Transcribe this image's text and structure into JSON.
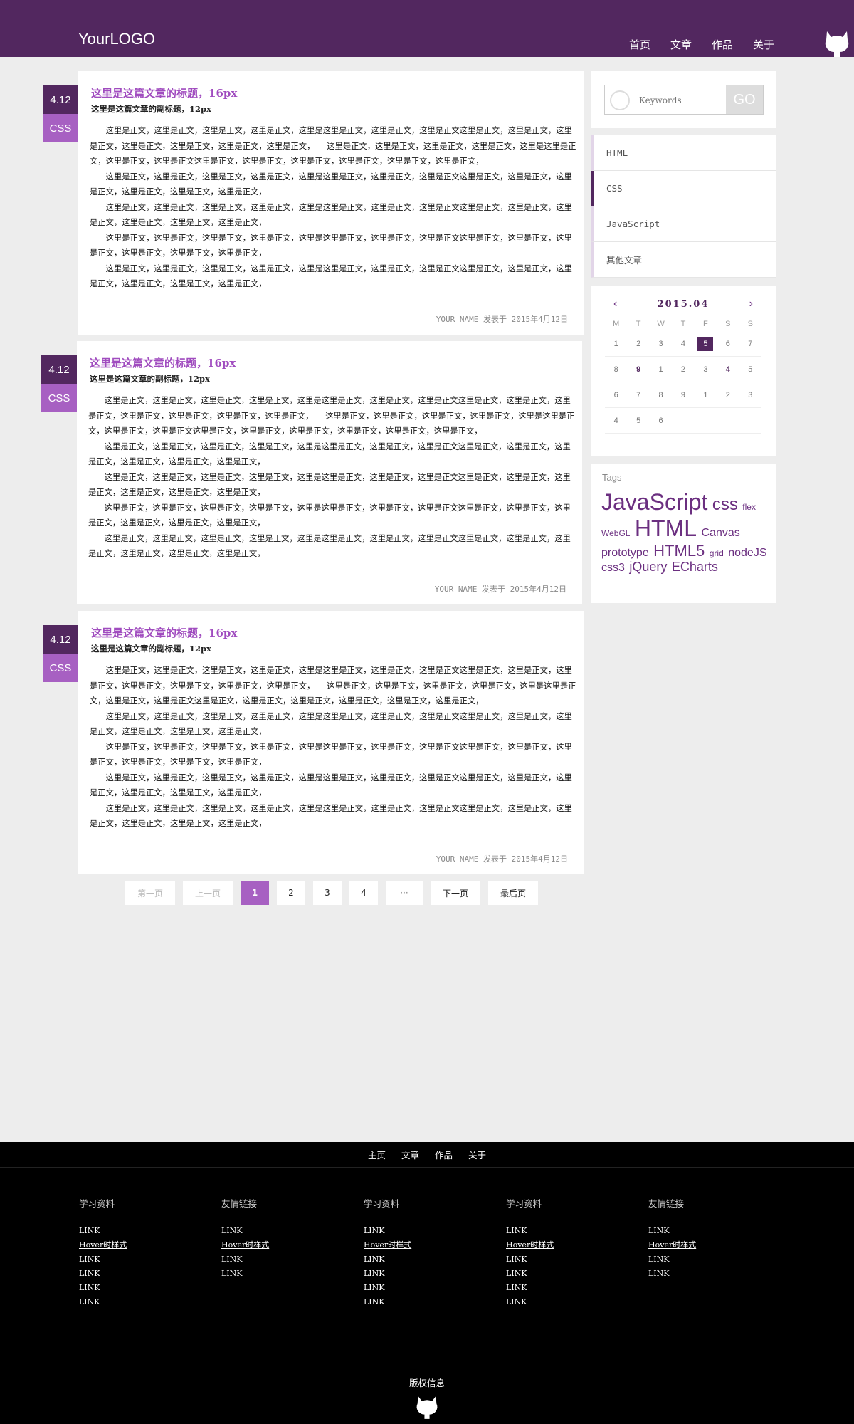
{
  "header": {
    "logo": "YourLOGO",
    "nav": [
      "首页",
      "文章",
      "作品",
      "关于"
    ]
  },
  "articles": [
    {
      "date": "4.12",
      "category": "CSS",
      "title": "这里是这篇文章的标题，16px",
      "subtitle": "这里是这篇文章的副标题，12px",
      "paragraphs": [
        "这里是正文，这里是正文，这里是正文，这里是正文，这里是这里是正文，这里是正文，这里是正文这里是正文，这里是正文，这里是正文，这里是正文，这里是正文，这里是正文，这里是正文，　　这里是正文，这里是正文，这里是正文，这里是正文，这里是这里是正文，这里是正文，这里是正文这里是正文，这里是正文，这里是正文，这里是正文，这里是正文，这里是正文，",
        "这里是正文，这里是正文，这里是正文，这里是正文，这里是这里是正文，这里是正文，这里是正文这里是正文，这里是正文，这里是正文，这里是正文，这里是正文，这里是正文，",
        "这里是正文，这里是正文，这里是正文，这里是正文，这里是这里是正文，这里是正文，这里是正文这里是正文，这里是正文，这里是正文，这里是正文，这里是正文，这里是正文，",
        "这里是正文，这里是正文，这里是正文，这里是正文，这里是这里是正文，这里是正文，这里是正文这里是正文，这里是正文，这里是正文，这里是正文，这里是正文，这里是正文，",
        "这里是正文，这里是正文，这里是正文，这里是正文，这里是这里是正文，这里是正文，这里是正文这里是正文，这里是正文，这里是正文，这里是正文，这里是正文，这里是正文，"
      ],
      "footer": "YOUR NAME 发表于 2015年4月12日"
    },
    {
      "date": "4.12",
      "category": "CSS",
      "title": "这里是这篇文章的标题，16px",
      "subtitle": "这里是这篇文章的副标题，12px",
      "paragraphs": [
        "这里是正文，这里是正文，这里是正文，这里是正文，这里是这里是正文，这里是正文，这里是正文这里是正文，这里是正文，这里是正文，这里是正文，这里是正文，这里是正文，这里是正文，　　这里是正文，这里是正文，这里是正文，这里是正文，这里是这里是正文，这里是正文，这里是正文这里是正文，这里是正文，这里是正文，这里是正文，这里是正文，这里是正文，",
        "这里是正文，这里是正文，这里是正文，这里是正文，这里是这里是正文，这里是正文，这里是正文这里是正文，这里是正文，这里是正文，这里是正文，这里是正文，这里是正文，",
        "这里是正文，这里是正文，这里是正文，这里是正文，这里是这里是正文，这里是正文，这里是正文这里是正文，这里是正文，这里是正文，这里是正文，这里是正文，这里是正文，",
        "这里是正文，这里是正文，这里是正文，这里是正文，这里是这里是正文，这里是正文，这里是正文这里是正文，这里是正文，这里是正文，这里是正文，这里是正文，这里是正文，",
        "这里是正文，这里是正文，这里是正文，这里是正文，这里是这里是正文，这里是正文，这里是正文这里是正文，这里是正文，这里是正文，这里是正文，这里是正文，这里是正文，"
      ],
      "footer": "YOUR NAME 发表于 2015年4月12日"
    },
    {
      "date": "4.12",
      "category": "CSS",
      "title": "这里是这篇文章的标题，16px",
      "subtitle": "这里是这篇文章的副标题，12px",
      "paragraphs": [
        "这里是正文，这里是正文，这里是正文，这里是正文，这里是这里是正文，这里是正文，这里是正文这里是正文，这里是正文，这里是正文，这里是正文，这里是正文，这里是正文，这里是正文，　　这里是正文，这里是正文，这里是正文，这里是正文，这里是这里是正文，这里是正文，这里是正文这里是正文，这里是正文，这里是正文，这里是正文，这里是正文，这里是正文，",
        "这里是正文，这里是正文，这里是正文，这里是正文，这里是这里是正文，这里是正文，这里是正文这里是正文，这里是正文，这里是正文，这里是正文，这里是正文，这里是正文，",
        "这里是正文，这里是正文，这里是正文，这里是正文，这里是这里是正文，这里是正文，这里是正文这里是正文，这里是正文，这里是正文，这里是正文，这里是正文，这里是正文，",
        "这里是正文，这里是正文，这里是正文，这里是正文，这里是这里是正文，这里是正文，这里是正文这里是正文，这里是正文，这里是正文，这里是正文，这里是正文，这里是正文，",
        "这里是正文，这里是正文，这里是正文，这里是正文，这里是这里是正文，这里是正文，这里是正文这里是正文，这里是正文，这里是正文，这里是正文，这里是正文，这里是正文，"
      ],
      "footer": "YOUR NAME 发表于 2015年4月12日"
    }
  ],
  "pagination": {
    "first": "第一页",
    "prev": "上一页",
    "pages": [
      "1",
      "2",
      "3",
      "4"
    ],
    "current": "1",
    "ellipsis": "···",
    "next": "下一页",
    "last": "最后页"
  },
  "sidebar": {
    "search": {
      "placeholder": "Keywords",
      "button": "GO"
    },
    "categories": [
      "HTML",
      "CSS",
      "JavaScript",
      "其他文章"
    ],
    "active_category": "CSS",
    "calendar": {
      "title": "2015.04",
      "prev": "‹",
      "next": "›",
      "weekdays": [
        "M",
        "T",
        "W",
        "T",
        "F",
        "S",
        "S"
      ],
      "rows": [
        [
          "1",
          "2",
          "3",
          "4",
          "5",
          "6",
          "7"
        ],
        [
          "8",
          "9",
          "1",
          "2",
          "3",
          "4",
          "5"
        ],
        [
          "6",
          "7",
          "8",
          "9",
          "1",
          "2",
          "3"
        ],
        [
          "4",
          "5",
          "6",
          "",
          "",
          "",
          ""
        ]
      ],
      "today": "5",
      "highlighted": [
        "9",
        "4"
      ]
    },
    "tags_title": "Tags",
    "tags": [
      {
        "text": "JavaScript",
        "size": 32
      },
      {
        "text": "css",
        "size": 24
      },
      {
        "text": "flex",
        "size": 12
      },
      {
        "text": "WebGL",
        "size": 12
      },
      {
        "text": "HTML",
        "size": 32
      },
      {
        "text": "Canvas",
        "size": 16
      },
      {
        "text": "prototype",
        "size": 16
      },
      {
        "text": "HTML5",
        "size": 22
      },
      {
        "text": "grid",
        "size": 12
      },
      {
        "text": "nodeJS",
        "size": 16
      },
      {
        "text": "css3",
        "size": 16
      },
      {
        "text": "jQuery",
        "size": 18
      },
      {
        "text": "ECharts",
        "size": 18
      }
    ]
  },
  "footer": {
    "nav": [
      "主页",
      "文章",
      "作品",
      "关于"
    ],
    "columns": [
      {
        "title": "学习资料",
        "links": [
          "LINK",
          "Hover时样式",
          "LINK",
          "LINK",
          "LINK",
          "LINK"
        ]
      },
      {
        "title": "友情链接",
        "links": [
          "LINK",
          "Hover时样式",
          "LINK",
          "LINK"
        ]
      },
      {
        "title": "学习资料",
        "links": [
          "LINK",
          "Hover时样式",
          "LINK",
          "LINK",
          "LINK",
          "LINK"
        ]
      },
      {
        "title": "学习资料",
        "links": [
          "LINK",
          "Hover时样式",
          "LINK",
          "LINK",
          "LINK",
          "LINK"
        ]
      },
      {
        "title": "友情链接",
        "links": [
          "LINK",
          "Hover时样式",
          "LINK",
          "LINK"
        ]
      }
    ],
    "copyright": "版权信息"
  },
  "icons": {
    "octocat": "github-octocat-icon",
    "search": "search-icon"
  },
  "colors": {
    "brand": "#52275f",
    "accent": "#a760c2",
    "title": "#a04cbf"
  }
}
